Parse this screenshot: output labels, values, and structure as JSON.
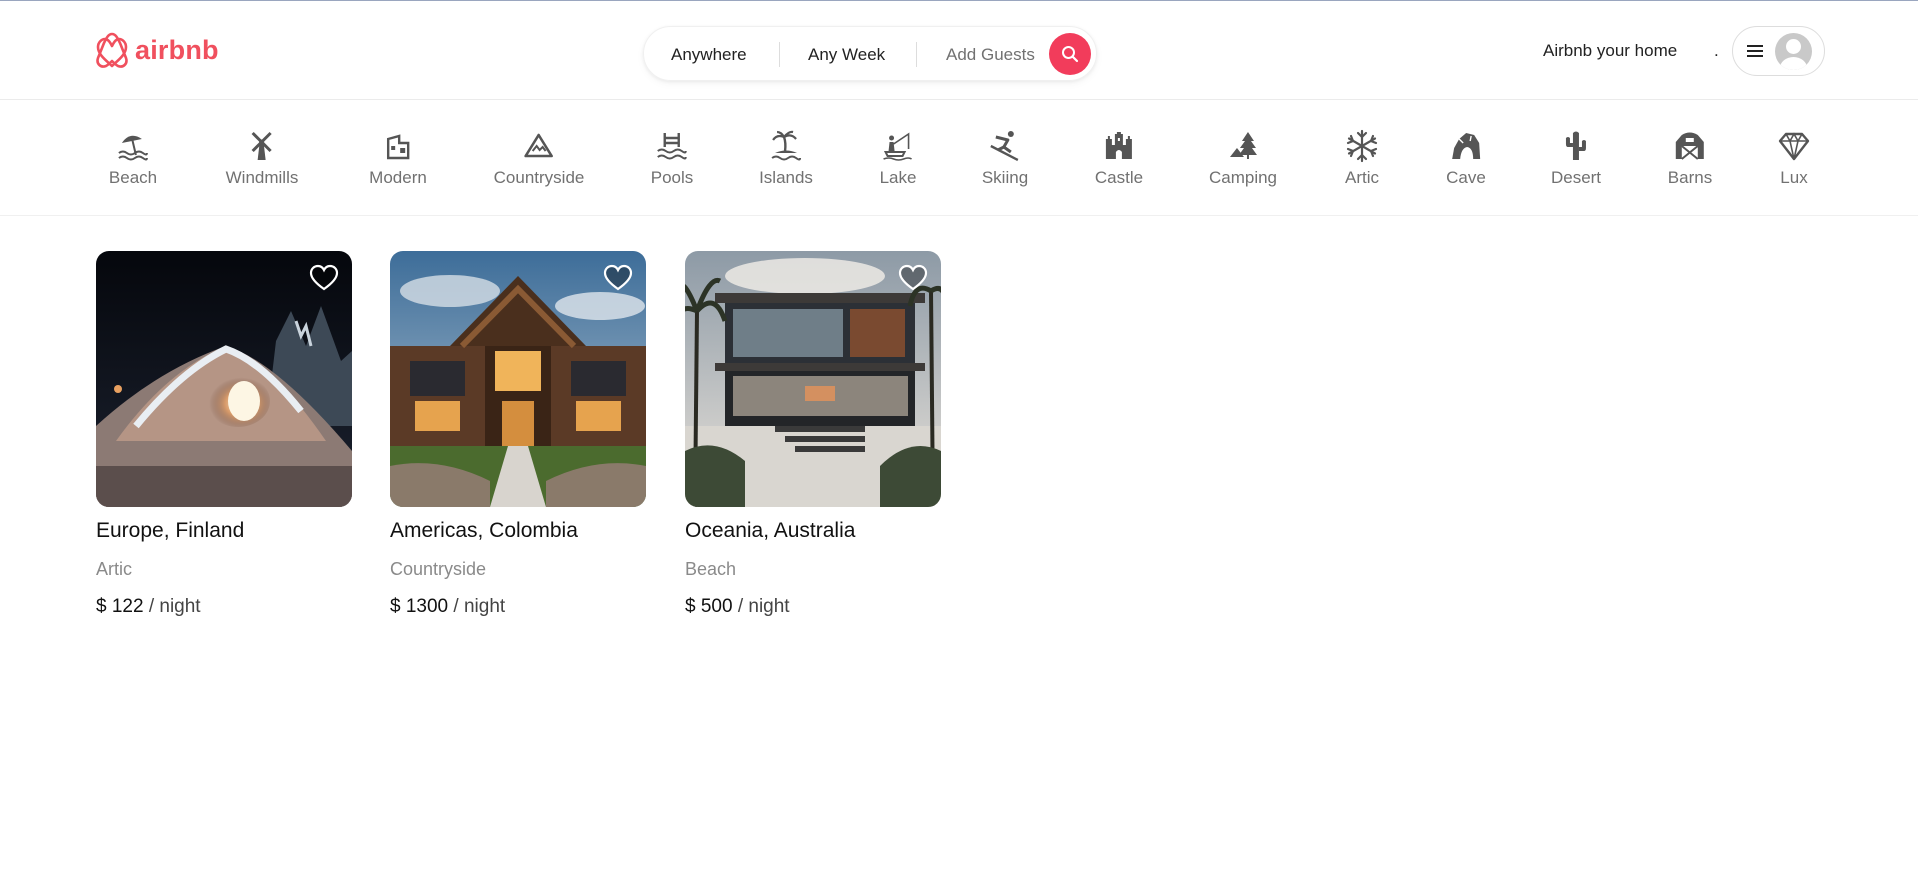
{
  "brand": {
    "name": "airbnb",
    "color": "#f0505e"
  },
  "search": {
    "where": "Anywhere",
    "when": "Any Week",
    "guests": "Add Guests",
    "button_icon": "search-icon",
    "accent": "#f23c5b"
  },
  "header_right": {
    "host_link": "Airbnb your home",
    "dot": ".",
    "menu_icon": "hamburger-icon",
    "avatar_icon": "user-avatar-icon"
  },
  "categories": [
    {
      "label": "Beach",
      "icon": "beach-umbrella-icon"
    },
    {
      "label": "Windmills",
      "icon": "windmill-icon"
    },
    {
      "label": "Modern",
      "icon": "modern-building-icon"
    },
    {
      "label": "Countryside",
      "icon": "mountain-icon"
    },
    {
      "label": "Pools",
      "icon": "pool-ladder-icon"
    },
    {
      "label": "Islands",
      "icon": "island-palm-icon"
    },
    {
      "label": "Lake",
      "icon": "lake-fishing-icon"
    },
    {
      "label": "Skiing",
      "icon": "skier-icon"
    },
    {
      "label": "Castle",
      "icon": "castle-icon"
    },
    {
      "label": "Camping",
      "icon": "camping-tree-icon"
    },
    {
      "label": "Artic",
      "icon": "snowflake-icon"
    },
    {
      "label": "Cave",
      "icon": "cave-icon"
    },
    {
      "label": "Desert",
      "icon": "cactus-icon"
    },
    {
      "label": "Barns",
      "icon": "barn-icon"
    },
    {
      "label": "Lux",
      "icon": "diamond-icon"
    }
  ],
  "listings": [
    {
      "location": "Europe, Finland",
      "category": "Artic",
      "price": "$ 122",
      "per": "/ night",
      "photo": "snow-igloo-photo"
    },
    {
      "location": "Americas, Colombia",
      "category": "Countryside",
      "price": "$ 1300",
      "per": "/ night",
      "photo": "timber-lodge-photo"
    },
    {
      "location": "Oceania, Australia",
      "category": "Beach",
      "price": "$ 500",
      "per": "/ night",
      "photo": "modern-beach-house-photo"
    }
  ]
}
